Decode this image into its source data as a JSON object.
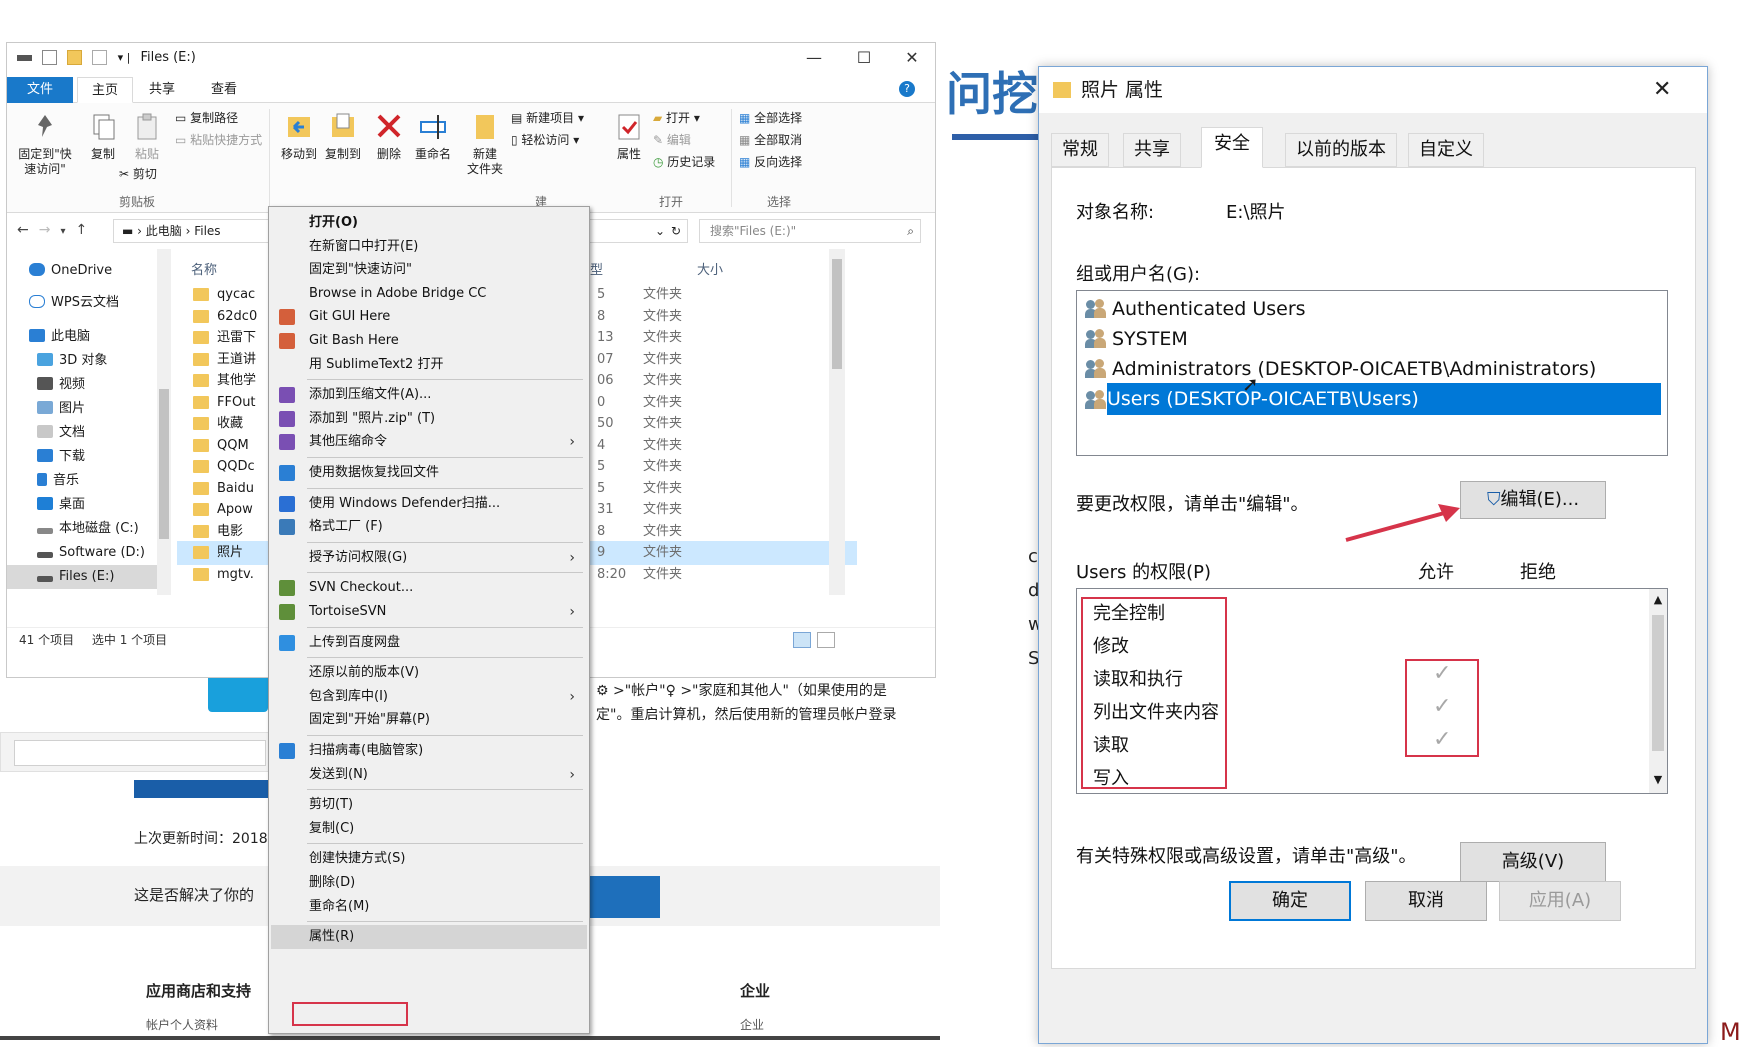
{
  "explorer": {
    "title": "Files (E:)",
    "window_buttons": [
      "—",
      "☐",
      "✕"
    ],
    "ribbon_tabs": [
      "文件",
      "主页",
      "共享",
      "查看"
    ],
    "ribbon": {
      "pin": "固定到\"快\n速访问\"",
      "copy": "复制",
      "paste": "粘贴",
      "copy_path": "复制路径",
      "paste_shortcut": "粘贴快捷方式",
      "cut": "剪切",
      "group_clipboard": "剪贴板",
      "move_to": "移动到",
      "copy_to": "复制到",
      "delete": "删除",
      "rename": "重命名",
      "new_folder": "新建\n文件夹",
      "new_item": "新建项目 ▾",
      "easy_access": "轻松访问 ▾",
      "group_new": "建",
      "properties": "属性",
      "open": "打开 ▾",
      "edit": "编辑",
      "history": "历史记录",
      "group_open": "打开",
      "select_all": "全部选择",
      "select_none": "全部取消",
      "invert": "反向选择",
      "group_select": "选择"
    },
    "address": {
      "crumb1": "此电脑",
      "crumb2": "Files",
      "search_placeholder": "搜索\"Files (E:)\""
    },
    "nav": [
      "OneDrive",
      "WPS云文档",
      "此电脑",
      "3D 对象",
      "视频",
      "图片",
      "文档",
      "下载",
      "音乐",
      "桌面",
      "本地磁盘 (C:)",
      "Software (D:)",
      "Files (E:)"
    ],
    "columns": {
      "name": "名称",
      "type": "类型",
      "size": "大小"
    },
    "files": [
      {
        "name": "qycac",
        "date": "5",
        "type": "文件夹"
      },
      {
        "name": "62dc0",
        "date": "8",
        "type": "文件夹"
      },
      {
        "name": "迅雷下",
        "date": "13",
        "type": "文件夹"
      },
      {
        "name": "王道讲",
        "date": "07",
        "type": "文件夹"
      },
      {
        "name": "其他学",
        "date": "06",
        "type": "文件夹"
      },
      {
        "name": "FFOut",
        "date": "0",
        "type": "文件夹"
      },
      {
        "name": "收藏",
        "date": "50",
        "type": "文件夹"
      },
      {
        "name": "QQM",
        "date": "4",
        "type": "文件夹"
      },
      {
        "name": "QQDc",
        "date": "5",
        "type": "文件夹"
      },
      {
        "name": "Baidu",
        "date": "5",
        "type": "文件夹"
      },
      {
        "name": "Apow",
        "date": "31",
        "type": "文件夹"
      },
      {
        "name": "电影",
        "date": "8",
        "type": "文件夹"
      },
      {
        "name": "照片",
        "date": "9",
        "type": "文件夹"
      },
      {
        "name": "mgtv.",
        "date": "8:20",
        "type": "文件夹"
      }
    ],
    "status": {
      "count": "41 个项目",
      "selected": "选中 1 个项目"
    }
  },
  "webpage": {
    "heading_fragment": "问挖",
    "line1": "⚙ >\"帐户\"♀ >\"家庭和其他人\"（如果使用的是",
    "line2": "定\"。重启计算机，然后使用新的管理员帐户登录",
    "updated": "上次更新时间：2018",
    "solved": "这是否解决了你的",
    "store": "应用商店和支持",
    "account": "帐户个人资料",
    "enterprise": "企业",
    "enterprise2": "企业",
    "mid_left": [
      "c",
      "d",
      "w",
      "S"
    ],
    "brand": "M"
  },
  "context_menu": [
    {
      "label": "打开(O)",
      "bold": true
    },
    {
      "label": "在新窗口中打开(E)"
    },
    {
      "label": "固定到\"快速访问\""
    },
    {
      "label": "Browse in Adobe Bridge CC"
    },
    {
      "label": "Git GUI Here",
      "icon": "#d45f3b"
    },
    {
      "label": "Git Bash Here",
      "icon": "#d45f3b"
    },
    {
      "label": "用 SublimeText2 打开"
    },
    {
      "sep": true
    },
    {
      "label": "添加到压缩文件(A)...",
      "icon": "#7a4fb3"
    },
    {
      "label": "添加到 \"照片.zip\" (T)",
      "icon": "#7a4fb3"
    },
    {
      "label": "其他压缩命令",
      "icon": "#7a4fb3",
      "sub": true
    },
    {
      "sep": true
    },
    {
      "label": "使用数据恢复找回文件",
      "icon": "#2a7fd4"
    },
    {
      "sep": true
    },
    {
      "label": "使用 Windows Defender扫描...",
      "icon": "#2a6fd4"
    },
    {
      "label": "格式工厂 (F)",
      "icon": "#3a7ab8"
    },
    {
      "sep": true
    },
    {
      "label": "授予访问权限(G)",
      "sub": true
    },
    {
      "sep": true
    },
    {
      "label": "SVN Checkout...",
      "icon": "#5f8f3a"
    },
    {
      "label": "TortoiseSVN",
      "icon": "#5f8f3a",
      "sub": true
    },
    {
      "sep": true
    },
    {
      "label": "上传到百度网盘",
      "icon": "#2f8fe0"
    },
    {
      "sep": true
    },
    {
      "label": "还原以前的版本(V)"
    },
    {
      "label": "包含到库中(I)",
      "sub": true
    },
    {
      "label": "固定到\"开始\"屏幕(P)"
    },
    {
      "sep": true
    },
    {
      "label": "扫描病毒(电脑管家)",
      "icon": "#2a7fd4"
    },
    {
      "label": "发送到(N)",
      "sub": true
    },
    {
      "sep": true
    },
    {
      "label": "剪切(T)"
    },
    {
      "label": "复制(C)"
    },
    {
      "sep": true
    },
    {
      "label": "创建快捷方式(S)"
    },
    {
      "label": "删除(D)"
    },
    {
      "label": "重命名(M)"
    },
    {
      "sep": true
    },
    {
      "label": "属性(R)",
      "highlight": true
    }
  ],
  "dialog": {
    "title": "照片 属性",
    "close": "✕",
    "tabs": [
      "常规",
      "共享",
      "安全",
      "以前的版本",
      "自定义"
    ],
    "object_label": "对象名称:",
    "object_value": "E:\\照片",
    "group_label": "组或用户名(G):",
    "users": [
      "Authenticated Users",
      "SYSTEM",
      "Administrators (DESKTOP-OICAETB\\Administrators)",
      "Users (DESKTOP-OICAETB\\Users)"
    ],
    "edit_hint": "要更改权限，请单击\"编辑\"。",
    "edit_button": "编辑(E)...",
    "perm_label": "Users 的权限(P)",
    "allow": "允许",
    "deny": "拒绝",
    "permissions": [
      "完全控制",
      "修改",
      "读取和执行",
      "列出文件夹内容",
      "读取",
      "写入"
    ],
    "check": "✓",
    "advanced_hint": "有关特殊权限或高级设置，请单击\"高级\"。",
    "advanced_button": "高级(V)",
    "ok": "确定",
    "cancel": "取消",
    "apply": "应用(A)"
  },
  "colors": {
    "accent": "#0078d7",
    "file_tab": "#1979ca",
    "annotation_red": "#d6344a"
  }
}
